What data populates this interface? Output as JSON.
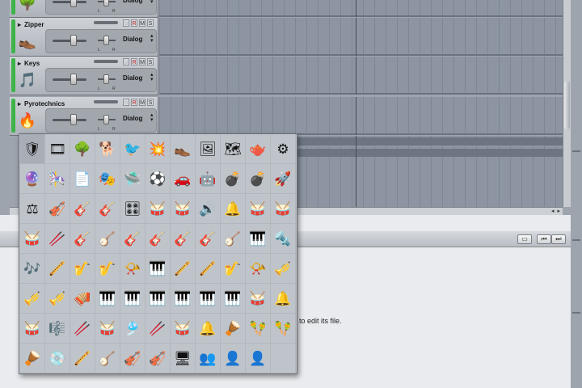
{
  "tracks": [
    {
      "name": "",
      "voice": "Dialog",
      "icon": "tree-icon",
      "glyph": "🌳"
    },
    {
      "name": "Zipper",
      "voice": "Dialog",
      "icon": "shoe-icon",
      "glyph": "👞"
    },
    {
      "name": "Keys",
      "voice": "Dialog",
      "icon": "wav-file-icon",
      "glyph": "🎵"
    },
    {
      "name": "Pyrotechnics",
      "voice": "Dialog",
      "icon": "explosion-icon",
      "glyph": "🔥"
    }
  ],
  "track_buttons": {
    "bulb": "◌",
    "rec": "R",
    "mute": "M",
    "solo": "S"
  },
  "pan_labels": {
    "left": "L",
    "right": "R"
  },
  "editor": {
    "hint": "to edit its file."
  },
  "editor_buttons": [
    "▭",
    "⏮",
    "⏭"
  ],
  "hscroll_arrows": "◂ ▸",
  "picker_icons": [
    {
      "name": "shield-icon",
      "g": "🛡"
    },
    {
      "name": "film-icon",
      "g": "🎞"
    },
    {
      "name": "tree-icon",
      "g": "🌳"
    },
    {
      "name": "dog-icon",
      "g": "🐕"
    },
    {
      "name": "bird-icon",
      "g": "🐦"
    },
    {
      "name": "explosion-icon",
      "g": "💥"
    },
    {
      "name": "shoe-icon",
      "g": "👞"
    },
    {
      "name": "frame-icon",
      "g": "🖼"
    },
    {
      "name": "map-icon",
      "g": "🗺"
    },
    {
      "name": "kettle-icon",
      "g": "🫖"
    },
    {
      "name": "gear-icon",
      "g": "⚙"
    },
    {
      "name": "glass-icon",
      "g": "🔮"
    },
    {
      "name": "carousel-icon",
      "g": "🎠"
    },
    {
      "name": "sheet-music-icon",
      "g": "📄"
    },
    {
      "name": "stage-icon",
      "g": "🎭"
    },
    {
      "name": "ufo-icon",
      "g": "🛸"
    },
    {
      "name": "soccer-ball-icon",
      "g": "⚽"
    },
    {
      "name": "car-icon",
      "g": "🚗"
    },
    {
      "name": "robot-icon",
      "g": "🤖"
    },
    {
      "name": "cannon-icon",
      "g": "💣"
    },
    {
      "name": "bomb-icon",
      "g": "💣"
    },
    {
      "name": "rocket-icon",
      "g": "🚀"
    },
    {
      "name": "scale-icon",
      "g": "⚖"
    },
    {
      "name": "cello-icon",
      "g": "🎻"
    },
    {
      "name": "electric-guitar-icon",
      "g": "🎸"
    },
    {
      "name": "bass-guitar-icon",
      "g": "🎸"
    },
    {
      "name": "synth-module-icon",
      "g": "🎛"
    },
    {
      "name": "cymbal-icon",
      "g": "🥁"
    },
    {
      "name": "drum-kit-icon",
      "g": "🥁"
    },
    {
      "name": "speaker-icon",
      "g": "🔊"
    },
    {
      "name": "gong-icon",
      "g": "🔔"
    },
    {
      "name": "snare-drum-icon",
      "g": "🥁"
    },
    {
      "name": "tom-drum-icon",
      "g": "🥁"
    },
    {
      "name": "bongos-icon",
      "g": "🥁"
    },
    {
      "name": "drumsticks-icon",
      "g": "🥢"
    },
    {
      "name": "acoustic-guitar-icon",
      "g": "🎸"
    },
    {
      "name": "banjo-icon",
      "g": "🪕"
    },
    {
      "name": "red-guitar-icon",
      "g": "🎸"
    },
    {
      "name": "sunburst-guitar-icon",
      "g": "🎸"
    },
    {
      "name": "blue-guitar-icon",
      "g": "🎸"
    },
    {
      "name": "lute-guitar-icon",
      "g": "🎸"
    },
    {
      "name": "mandolin-icon",
      "g": "🪕"
    },
    {
      "name": "harmonica-icon",
      "g": "🎹"
    },
    {
      "name": "pipe-icon",
      "g": "🔩"
    },
    {
      "name": "bagpipes-icon",
      "g": "🎶"
    },
    {
      "name": "flute-icon",
      "g": "🪈"
    },
    {
      "name": "clarinet-icon",
      "g": "🎷"
    },
    {
      "name": "oboe-icon",
      "g": "🎷"
    },
    {
      "name": "french-horn-icon",
      "g": "📯"
    },
    {
      "name": "keytar-icon",
      "g": "🎹"
    },
    {
      "name": "pan-flute-icon",
      "g": "🪈"
    },
    {
      "name": "recorder-icon",
      "g": "🪈"
    },
    {
      "name": "saxophone-icon",
      "g": "🎷"
    },
    {
      "name": "tuba-icon",
      "g": "📯"
    },
    {
      "name": "trombone-icon",
      "g": "🎺"
    },
    {
      "name": "trumpet-icon",
      "g": "🎺"
    },
    {
      "name": "brass-section-icon",
      "g": "🎺"
    },
    {
      "name": "accordion-icon",
      "g": "🪗"
    },
    {
      "name": "keyboard-icon",
      "g": "🎹"
    },
    {
      "name": "piano-keys-icon",
      "g": "🎹"
    },
    {
      "name": "organ-icon",
      "g": "🎹"
    },
    {
      "name": "synth-keys-icon",
      "g": "🎹"
    },
    {
      "name": "red-keyboard-icon",
      "g": "🎹"
    },
    {
      "name": "white-keyboard-icon",
      "g": "🎹"
    },
    {
      "name": "conga-drums-icon",
      "g": "🥁"
    },
    {
      "name": "bell-icon",
      "g": "🔔"
    },
    {
      "name": "timpani-icon",
      "g": "🥁"
    },
    {
      "name": "xylophone-icon",
      "g": "🎼"
    },
    {
      "name": "mallets-icon",
      "g": "🥢"
    },
    {
      "name": "bongo-drums-icon",
      "g": "🥁"
    },
    {
      "name": "wind-chimes-icon",
      "g": "🎐"
    },
    {
      "name": "claves-icon",
      "g": "🥢"
    },
    {
      "name": "tabla-icon",
      "g": "🥁"
    },
    {
      "name": "cowbell-icon",
      "g": "🔔"
    },
    {
      "name": "tam-tam-icon",
      "g": "🪘"
    },
    {
      "name": "maracas-icon",
      "g": "🪇"
    },
    {
      "name": "castanets-icon",
      "g": "🪇"
    },
    {
      "name": "tambourine-icon",
      "g": "🪘"
    },
    {
      "name": "record-icon",
      "g": "💿"
    },
    {
      "name": "didgeridoo-icon",
      "g": "🪈"
    },
    {
      "name": "sitar-icon",
      "g": "🪕"
    },
    {
      "name": "violin-icon",
      "g": "🎻"
    },
    {
      "name": "string-ensemble-icon",
      "g": "🎻"
    },
    {
      "name": "screen-icon",
      "g": "🖥"
    },
    {
      "name": "choir-icon",
      "g": "👥"
    },
    {
      "name": "person-silhouette-icon",
      "g": "👤"
    },
    {
      "name": "person-silhouette-2-icon",
      "g": "👤"
    },
    {
      "name": "empty-slot-icon",
      "g": ""
    }
  ],
  "picker_selected": 0
}
